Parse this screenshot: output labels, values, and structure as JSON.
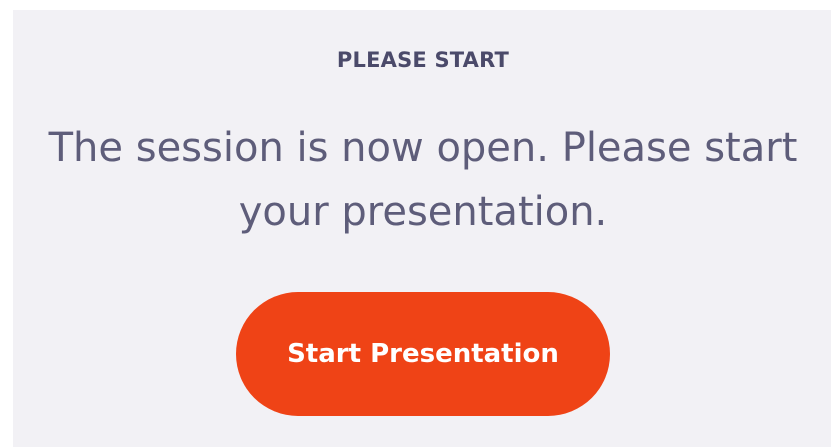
{
  "session": {
    "heading": "PLEASE START",
    "message": "The session is now open. Please start your presentation.",
    "start_button_label": "Start Presentation"
  },
  "colors": {
    "panel_background": "#f2f1f5",
    "heading_text": "#4b4a6a",
    "message_text": "#5e5d7a",
    "button_background": "#ef4316",
    "button_text": "#ffffff"
  }
}
